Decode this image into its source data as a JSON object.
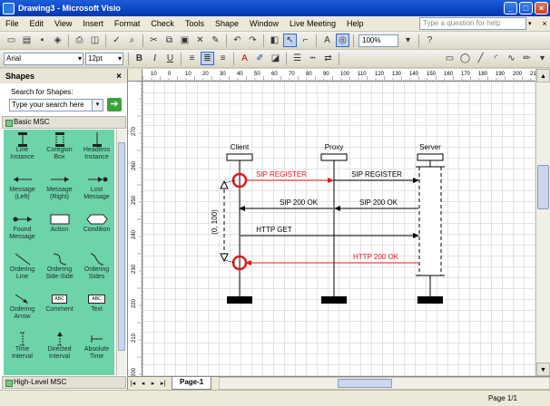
{
  "window": {
    "title": "Drawing3 - Microsoft Visio",
    "minimize": "_",
    "restore": "□",
    "close": "×"
  },
  "menu": {
    "items": [
      "File",
      "Edit",
      "View",
      "Insert",
      "Format",
      "Check",
      "Tools",
      "Shape",
      "Window",
      "Live Meeting",
      "Help"
    ],
    "ask_placeholder": "Type a question for help",
    "ask_arrow": "▾",
    "mdi_controls": [
      "×"
    ]
  },
  "toolbar": {
    "zoom": "100%"
  },
  "format_toolbar": {
    "font": "Arial",
    "size": "12pt",
    "bold": "B",
    "italic": "I",
    "underline": "U"
  },
  "shapes_pane": {
    "title": "Shapes",
    "close": "×",
    "search_label": "Search for Shapes:",
    "search_placeholder": "Type your search here",
    "search_go": "➔",
    "stencils": [
      "Basic MSC",
      "High-Level MSC"
    ],
    "shapes": [
      {
        "label": "Line Instance",
        "icon": "line-instance-icon"
      },
      {
        "label": "Coregion Box",
        "icon": "coregion-box-icon"
      },
      {
        "label": "Headless Instance",
        "icon": "headless-instance-icon"
      },
      {
        "label": "Message (Left)",
        "icon": "message-left-icon"
      },
      {
        "label": "Message (Right)",
        "icon": "message-right-icon"
      },
      {
        "label": "Lost Message",
        "icon": "lost-message-icon"
      },
      {
        "label": "Found Message",
        "icon": "found-message-icon"
      },
      {
        "label": "Action",
        "icon": "action-icon"
      },
      {
        "label": "Condition",
        "icon": "condition-icon"
      },
      {
        "label": "Ordering Line",
        "icon": "ordering-line-icon"
      },
      {
        "label": "Ordering Side-Side",
        "icon": "ordering-side-side-icon"
      },
      {
        "label": "Ordering Sides",
        "icon": "ordering-sides-icon"
      },
      {
        "label": "Ordering Arrow",
        "icon": "ordering-arrow-icon"
      },
      {
        "label": "Comment",
        "icon": "comment-icon"
      },
      {
        "label": "Text",
        "icon": "text-icon"
      },
      {
        "label": "Time Interval",
        "icon": "time-interval-icon"
      },
      {
        "label": "Directed Interval",
        "icon": "directed-interval-icon"
      },
      {
        "label": "Absolute Time",
        "icon": "absolute-time-icon"
      }
    ],
    "comment_glyph": "ABC",
    "text_glyph": "ABC"
  },
  "ruler_h": {
    "ticks": [
      "10",
      "0",
      "10",
      "20",
      "30",
      "40",
      "50",
      "60",
      "70",
      "80",
      "90",
      "100",
      "110",
      "120",
      "130",
      "140",
      "150",
      "160",
      "170",
      "180",
      "190",
      "200",
      "210"
    ]
  },
  "ruler_v": {
    "ticks": [
      "270",
      "260",
      "250",
      "240",
      "230",
      "220",
      "210",
      "200"
    ]
  },
  "diagram": {
    "instances": [
      "Client",
      "Proxy",
      "Server"
    ],
    "messages": [
      {
        "label": "SIP REGISTER",
        "color": "#e0191e"
      },
      {
        "label": "SIP REGISTER",
        "color": "#000000"
      },
      {
        "label": "SIP 200 OK",
        "color": "#000000"
      },
      {
        "label": "SIP 200 OK",
        "color": "#000000"
      },
      {
        "label": "HTTP GET",
        "color": "#000000"
      },
      {
        "label": "HTTP 200 OK",
        "color": "#e0191e"
      }
    ],
    "interval_label": "(0, 100)",
    "highlight_color": "#e0191e"
  },
  "page_tabs": {
    "nav": [
      "|◂",
      "◂",
      "▸",
      "▸|"
    ],
    "current": "Page-1"
  },
  "status": {
    "page": "Page 1/1"
  }
}
